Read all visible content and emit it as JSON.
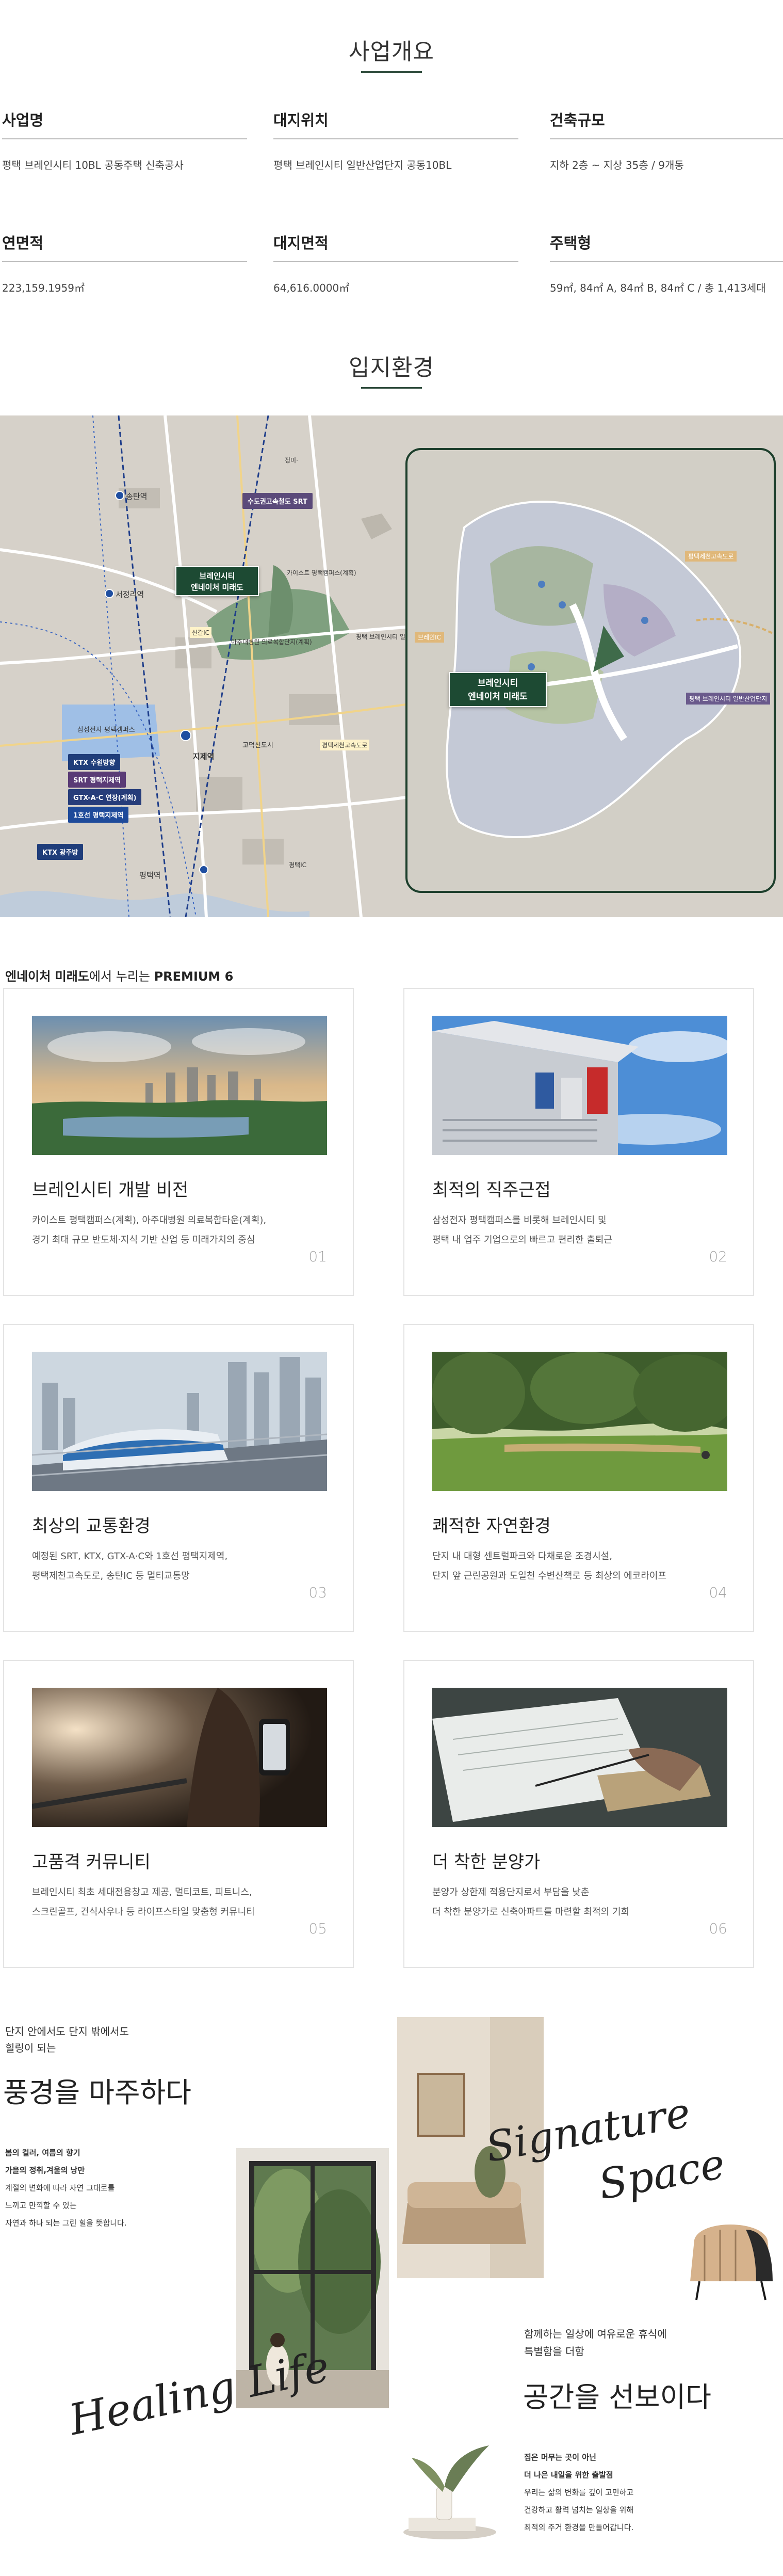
{
  "overview": {
    "title": "사업개요",
    "items": [
      {
        "label": "사업명",
        "value": "평택 브레인시티 10BL 공동주택 신축공사"
      },
      {
        "label": "대지위치",
        "value": "평택 브레인시티 일반산업단지 공동10BL"
      },
      {
        "label": "건축규모",
        "value": "지하 2층 ~ 지상 35층 / 9개동"
      },
      {
        "label": "연면적",
        "value": "223,159.1959㎡"
      },
      {
        "label": "대지면적",
        "value": "64,616.0000㎡"
      },
      {
        "label": "주택형",
        "value": "59㎡, 84㎡ A, 84㎡ B, 84㎡ C / 총 1,413세대"
      }
    ]
  },
  "location": {
    "title": "입지환경",
    "site_name_line1": "브레인시티",
    "site_name_line2": "엔네이처 미래도",
    "labels": {
      "songtan": "송탄역",
      "seojeongri": "서정리역",
      "srt_station": "수도권고속철도 SRT",
      "samsung": "삼성전자 평택캠퍼스",
      "kaist": "카이스트 평택캠퍼스(계획)",
      "ajou": "아주대병원 의료복합단지(계획)",
      "jijesan": "지제역",
      "pyeongtaek_station": "평택역",
      "sinsan_ic": "신갈IC",
      "godeok": "고덕신도시",
      "expressway": "평택제천고속도로",
      "industrial": "평택 브레인시티 일반산업단지",
      "brainic": "브레인IC",
      "jinwi": "진위역"
    },
    "badges": {
      "ktx": "KTX 수원방향",
      "srt": "SRT 평택지제역",
      "gtx": "GTX-A·C 연장(계획)",
      "line1": "1호선 평택지제역",
      "ktx_south": "KTX 광주방",
      "north": "정미·",
      "south": "평택IC"
    }
  },
  "premium": {
    "brand": "엔네이처 미래도",
    "middle": "에서 누리는 ",
    "tag": "PREMIUM 6"
  },
  "cards": [
    {
      "title": "브레인시티 개발 비전",
      "desc1": "카이스트 평택캠퍼스(계획), 아주대병원 의료복합타운(계획),",
      "desc2": "경기 최대 규모 반도체·지식 기반 산업 등 미래가치의 중심",
      "num": "01"
    },
    {
      "title": "최적의 직주근접",
      "desc1": "삼성전자 평택캠퍼스를 비롯해 브레인시티 및",
      "desc2": "평택 내 업주 기업으로의 빠르고 편리한 출퇴근",
      "num": "02"
    },
    {
      "title": "최상의 교통환경",
      "desc1": "예정된 SRT, KTX, GTX-A·C와 1호선 평택지제역,",
      "desc2": "평택제천고속도로, 송탄IC 등 멀티교통망",
      "num": "03"
    },
    {
      "title": "쾌적한 자연환경",
      "desc1": "단지 내 대형 센트럴파크와 다채로운 조경시설,",
      "desc2": "단지 앞 근린공원과 도일천 수변산책로 등 최상의 에코라이프",
      "num": "04"
    },
    {
      "title": "고품격 커뮤니티",
      "desc1": "브레인시티 최초 세대전용창고 제공, 멀티코트, 피트니스,",
      "desc2": "스크린골프, 건식사우나 등 라이프스타일 맞춤형 커뮤니티",
      "num": "05"
    },
    {
      "title": "더 착한 분양가",
      "desc1": "분양가 상한제 적용단지로서 부담을 낮춘",
      "desc2": "더 착한 분양가로 신축아파트를 마련할 최적의 기회",
      "num": "06"
    }
  ],
  "healing": {
    "intro1": "단지 안에서도 단지 밖에서도",
    "intro2": "힐링이 되는",
    "headline": "풍경을 마주하다",
    "sub_bold1": "봄의 컬러, 여름의 향기",
    "sub_bold2": "가을의 정취,겨울의 낭만",
    "sub1": "계절의 변화에 따라 자연 그대로를",
    "sub2": "느끼고 만끽할 수 있는",
    "sub3": "자연과 하나 되는 그린 힐을 뜻합니다.",
    "script_left": "Healing Life",
    "script_right_1": "Signature",
    "script_right_2": "Space",
    "right_intro1": "함께하는 일상에 여유로운 휴식에",
    "right_intro2": "특별함을 더함",
    "right_headline": "공간을 선보이다",
    "right_bold1": "집은 머무는 곳이 아닌",
    "right_bold2": "더 나은 내일을 위한 출발점",
    "right1": "우리는 삶의 변화를 깊이 고민하고",
    "right2": "건강하고 활력 넘치는 일상을 위해",
    "right3": "최적의 주거 환경을 만들어갑니다."
  },
  "colors": {
    "accent": "#1d4a33",
    "rule": "#2c4a3a"
  }
}
